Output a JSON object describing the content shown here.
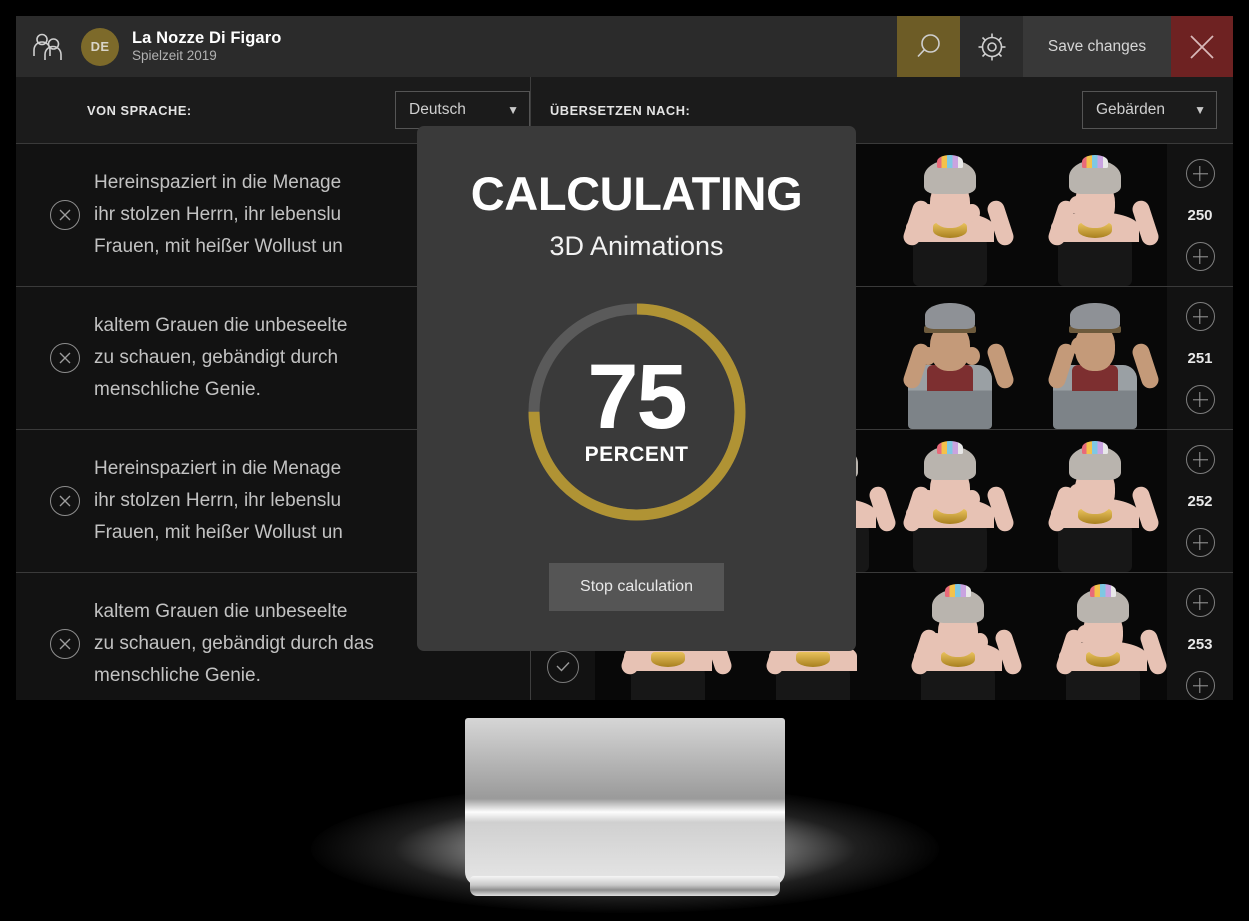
{
  "header": {
    "users_icon": "users-icon",
    "language_badge": "DE",
    "title": "La Nozze Di Figaro",
    "subtitle": "Spielzeit 2019",
    "search_icon": "search-icon",
    "settings_icon": "gear-icon",
    "save_label": "Save changes",
    "close_icon": "close-icon",
    "colors": {
      "search_bg": "#6d5c26",
      "close_bg": "#6e2222",
      "badge_bg": "#7d6a2a",
      "header_bg": "#2b2b2b"
    }
  },
  "language_bar": {
    "from_label": "VON SPRACHE:",
    "from_value": "Deutsch",
    "to_label": "ÜBERSETZEN NACH:",
    "to_value": "Gebärden",
    "caret": "▼"
  },
  "rows": [
    {
      "number": "250",
      "text": "Hereinspaziert in die Menage\nihr stolzen Herrn, ihr lebenslu\nFrauen, mit heißer Wollust un",
      "delete_icon": "close-circle-icon",
      "add_icon_top": "plus-circle-icon",
      "add_icon_bottom": "plus-circle-icon",
      "character": "lady",
      "avatar_count": 2
    },
    {
      "number": "251",
      "text": "kaltem Grauen die unbeseelte\nzu schauen, gebändigt durch\nmenschliche Genie.",
      "delete_icon": "close-circle-icon",
      "add_icon_top": "plus-circle-icon",
      "add_icon_bottom": "plus-circle-icon",
      "character": "soldier",
      "avatar_count": 2
    },
    {
      "number": "252",
      "text": "Hereinspaziert in die Menage\nihr stolzen Herrn, ihr lebenslu\nFrauen, mit heißer Wollust un",
      "delete_icon": "close-circle-icon",
      "add_icon_top": "plus-circle-icon",
      "add_icon_bottom": "plus-circle-icon",
      "character": "lady",
      "avatar_count": 3
    },
    {
      "number": "253",
      "text": "kaltem Grauen die unbeseelte\nzu schauen, gebändigt durch das\nmenschliche Genie.",
      "delete_icon": "close-circle-icon",
      "add_icon_top": "plus-circle-icon",
      "add_icon_bottom": "plus-circle-icon",
      "character": "lady",
      "avatar_count": 4,
      "play_icon": "play-circle-icon",
      "approve_icon": "check-circle-icon"
    }
  ],
  "modal": {
    "title": "CALCULATING",
    "subtitle": "3D Animations",
    "percent": "75",
    "percent_unit": "PERCENT",
    "progress_value": 75,
    "stop_label": "Stop calculation",
    "colors": {
      "progress_fill": "#b09334",
      "progress_track": "#5a5a5a",
      "panel_bg": "#3a3a3a",
      "button_bg": "#555555"
    }
  }
}
